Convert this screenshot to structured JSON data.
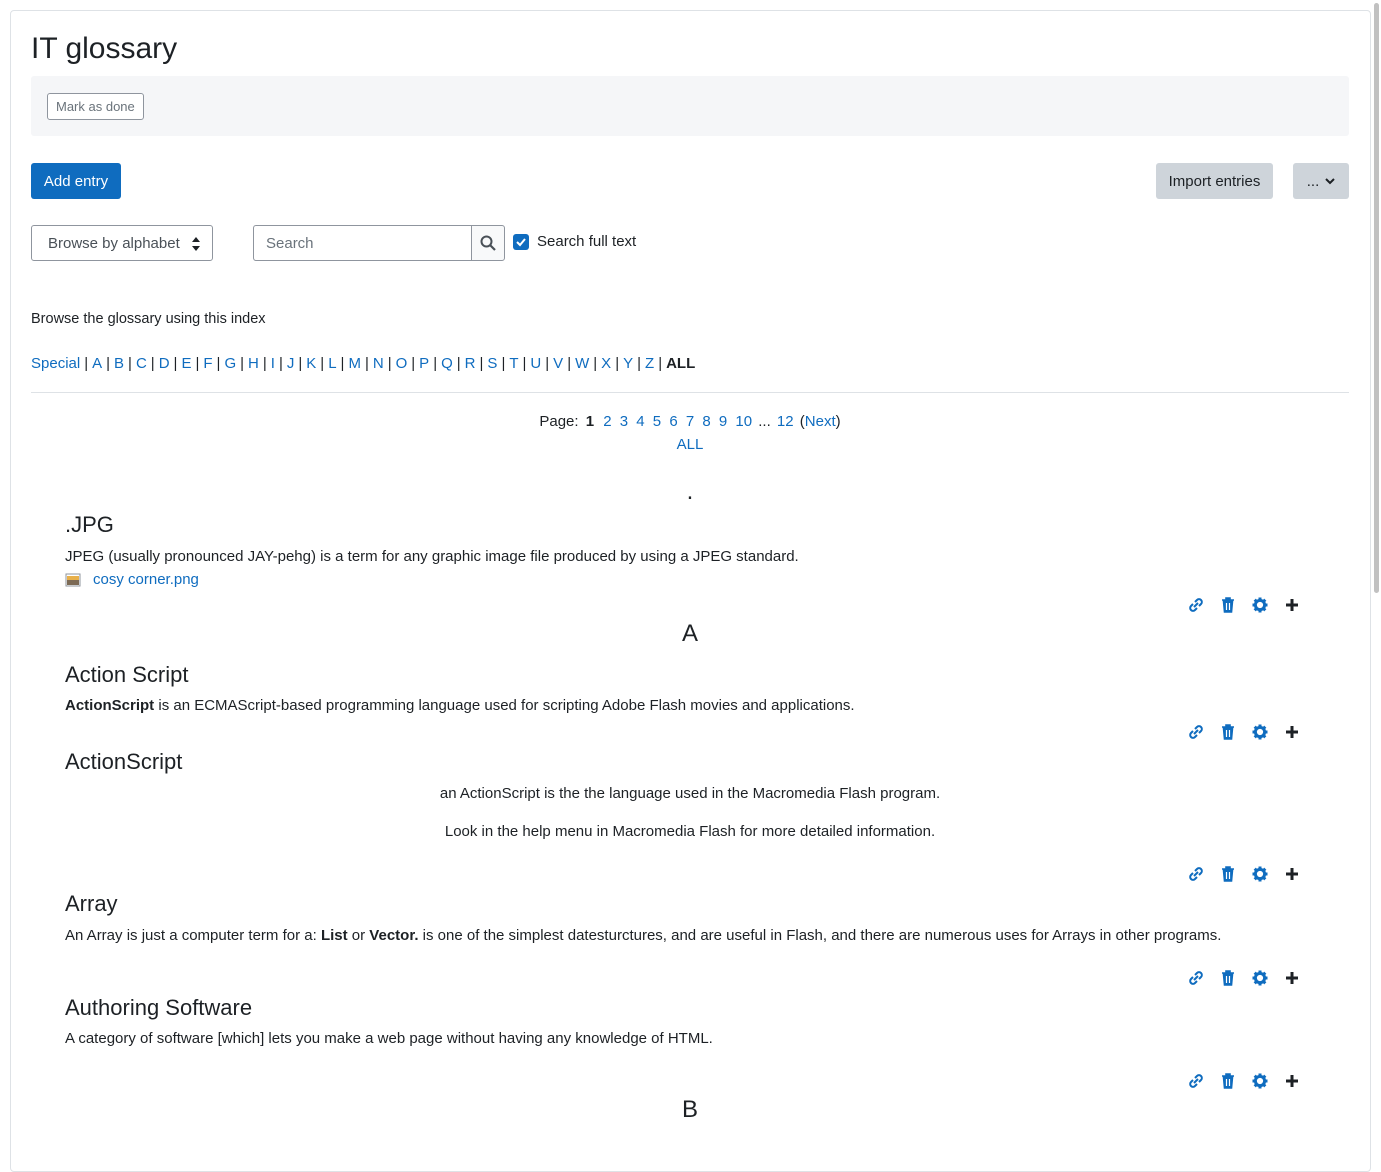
{
  "page": {
    "title": "IT glossary"
  },
  "completion": {
    "mark_label": "Mark as done"
  },
  "toolbar": {
    "add_label": "Add entry",
    "import_label": "Import entries",
    "more_label": "..."
  },
  "browse": {
    "select_value": "Browse by alphabet"
  },
  "search": {
    "placeholder": "Search",
    "fulltext_label": "Search full text",
    "fulltext_checked": true
  },
  "index": {
    "intro": "Browse the glossary using this index",
    "letters": [
      "Special",
      "A",
      "B",
      "C",
      "D",
      "E",
      "F",
      "G",
      "H",
      "I",
      "J",
      "K",
      "L",
      "M",
      "N",
      "O",
      "P",
      "Q",
      "R",
      "S",
      "T",
      "U",
      "V",
      "W",
      "X",
      "Y",
      "Z"
    ],
    "current": "ALL"
  },
  "pager": {
    "label": "Page:",
    "current": "1",
    "pages": [
      "2",
      "3",
      "4",
      "5",
      "6",
      "7",
      "8",
      "9",
      "10"
    ],
    "ellipsis": "...",
    "last": "12",
    "open_paren": "(",
    "next": "Next",
    "close_paren": ")",
    "all": "ALL"
  },
  "sections": {
    "dot": ".",
    "a": "A",
    "b": "B"
  },
  "entries": {
    "jpg": {
      "title": ".JPG",
      "text": "JPEG (usually pronounced JAY-pehg) is a term for any graphic image file produced by using a JPEG standard.",
      "attachment": "cosy corner.png"
    },
    "action_script": {
      "title": "Action Script",
      "bold": "ActionScript",
      "text": " is an ECMAScript-based programming language used for scripting Adobe Flash movies and applications."
    },
    "actionscript": {
      "title": "ActionScript",
      "line1": "an ActionScript is the the language used in the Macromedia Flash program.",
      "line2": "Look in the help menu in Macromedia Flash for more detailed information."
    },
    "array": {
      "title": "Array",
      "t1": "An Array is just a computer term for a: ",
      "b1": "List",
      "t2": " or ",
      "b2": "Vector.",
      "t3": " is one of the simplest datesturctures, and are useful in Flash, and there are numerous uses for Arrays in other programs."
    },
    "authoring": {
      "title": "Authoring Software",
      "text": "A category of software [which] lets you make a web page without having any knowledge of HTML."
    }
  },
  "action_icons": [
    "link-icon",
    "trash-icon",
    "gear-icon",
    "plus-icon"
  ],
  "colors": {
    "primary": "#0f6cbf",
    "secondary": "#ced4da",
    "text": "#1d2125"
  }
}
